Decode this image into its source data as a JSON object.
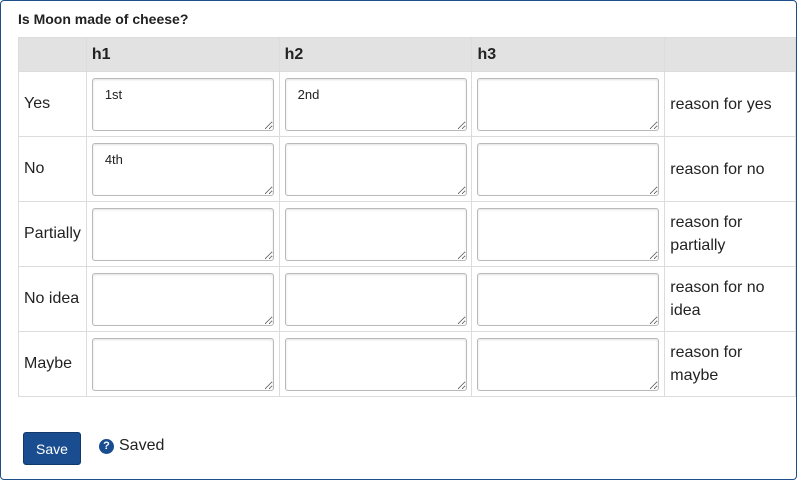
{
  "question": "Is Moon made of cheese?",
  "columns": [
    "h1",
    "h2",
    "h3",
    ""
  ],
  "rows": [
    {
      "label": "Yes",
      "values": [
        "1st",
        "2nd",
        ""
      ],
      "reason": "reason for yes"
    },
    {
      "label": "No",
      "values": [
        "4th",
        "",
        ""
      ],
      "reason": "reason for no"
    },
    {
      "label": "Partially",
      "values": [
        "",
        "",
        ""
      ],
      "reason": "reason for partially"
    },
    {
      "label": "No idea",
      "values": [
        "",
        "",
        ""
      ],
      "reason": "reason for no idea"
    },
    {
      "label": "Maybe",
      "values": [
        "",
        "",
        ""
      ],
      "reason": "reason for maybe"
    }
  ],
  "save_label": "Save",
  "status_text": "Saved",
  "help_icon": "question-circle-icon",
  "colors": {
    "primary": "#1a4d8f",
    "header_bg": "#e2e2e2"
  }
}
